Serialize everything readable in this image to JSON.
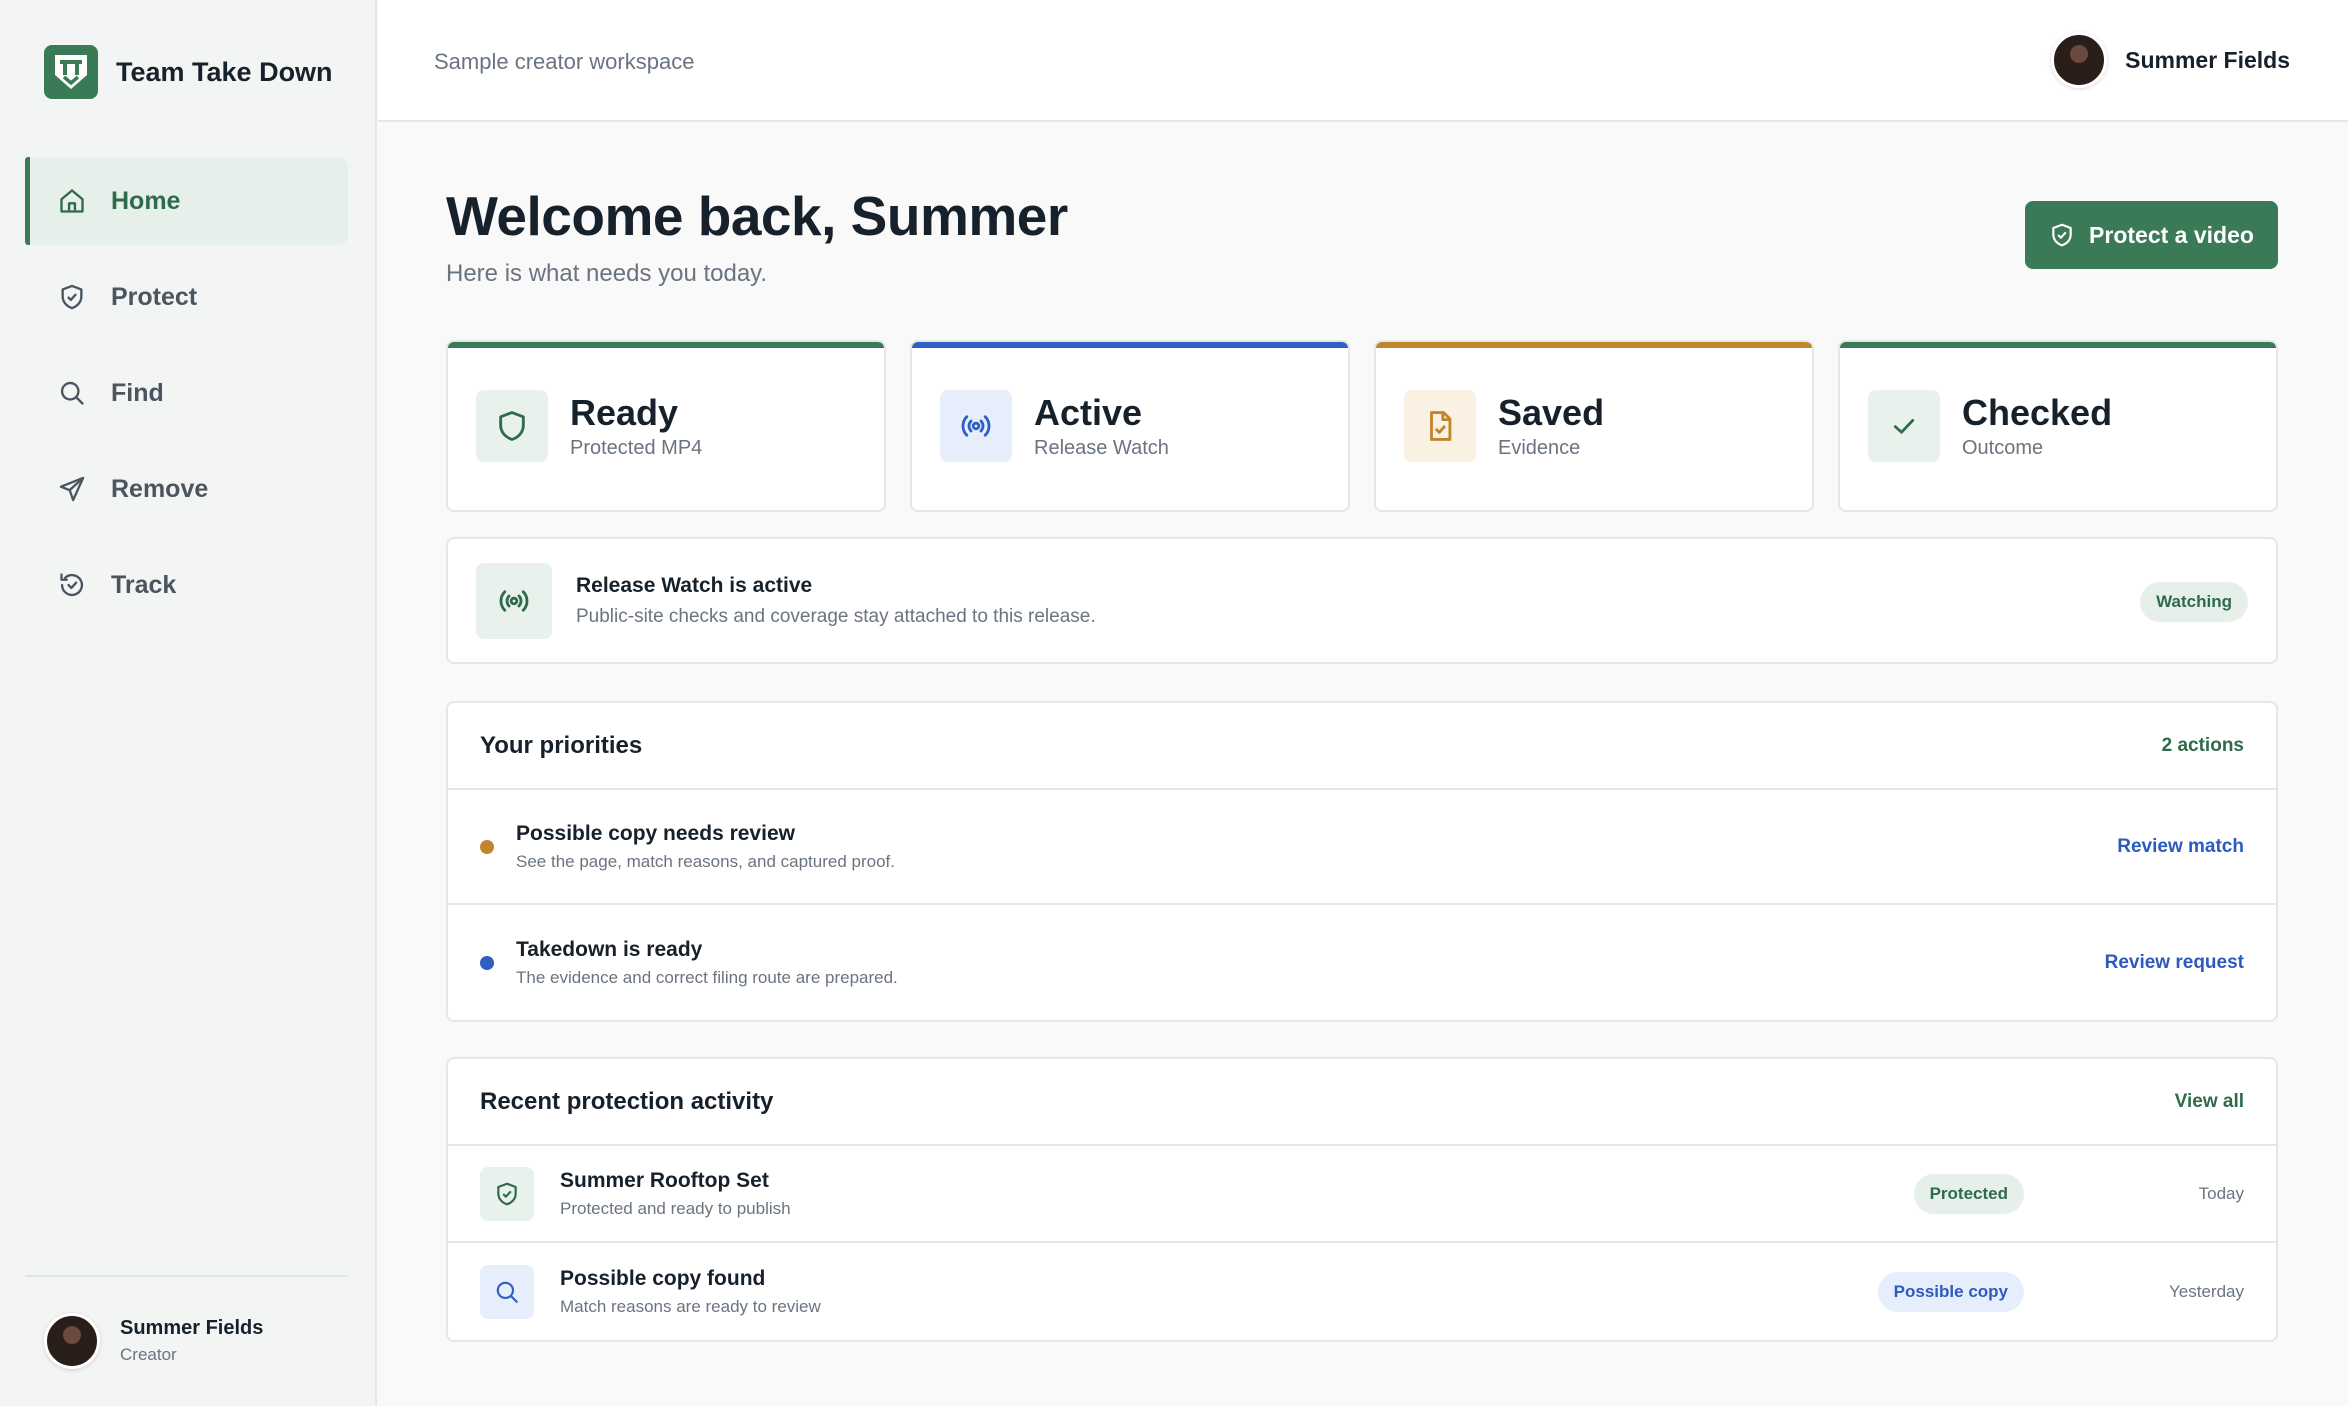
{
  "brand": {
    "name": "Team Take Down"
  },
  "sidebar": {
    "items": [
      {
        "label": "Home",
        "icon": "home-icon",
        "active": true
      },
      {
        "label": "Protect",
        "icon": "shield-check-icon"
      },
      {
        "label": "Find",
        "icon": "search-icon"
      },
      {
        "label": "Remove",
        "icon": "send-icon"
      },
      {
        "label": "Track",
        "icon": "history-icon"
      }
    ],
    "user": {
      "name": "Summer Fields",
      "role": "Creator"
    }
  },
  "topbar": {
    "workspace": "Sample creator workspace",
    "user_name": "Summer Fields"
  },
  "main": {
    "welcome": "Welcome back, Summer",
    "subtitle": "Here is what needs you today.",
    "cta_label": "Protect a video",
    "stats": [
      {
        "title": "Ready",
        "sub": "Protected MP4",
        "icon": "shield-icon",
        "accent": "#3a7a57"
      },
      {
        "title": "Active",
        "sub": "Release Watch",
        "icon": "broadcast-icon",
        "accent": "#2f5fc4"
      },
      {
        "title": "Saved",
        "sub": "Evidence",
        "icon": "file-check-icon",
        "accent": "#c0862e"
      },
      {
        "title": "Checked",
        "sub": "Outcome",
        "icon": "check-icon",
        "accent": "#3a7a57"
      }
    ],
    "watch": {
      "title": "Release Watch is active",
      "sub": "Public-site checks and coverage stay attached to this release.",
      "badge": "Watching"
    },
    "priorities": {
      "title": "Your priorities",
      "count": "2 actions",
      "rows": [
        {
          "title": "Possible copy needs review",
          "sub": "See the page, match reasons, and captured proof.",
          "action": "Review match",
          "dot": "#c0862e"
        },
        {
          "title": "Takedown is ready",
          "sub": "The evidence and correct filing route are prepared.",
          "action": "Review request",
          "dot": "#2f5fc4"
        }
      ]
    },
    "activity": {
      "title": "Recent protection activity",
      "link": "View all",
      "rows": [
        {
          "title": "Summer Rooftop Set",
          "sub": "Protected and ready to publish",
          "badge": "Protected",
          "date": "Today"
        },
        {
          "title": "Possible copy found",
          "sub": "Match reasons are ready to review",
          "badge": "Possible copy",
          "date": "Yesterday"
        }
      ]
    }
  }
}
